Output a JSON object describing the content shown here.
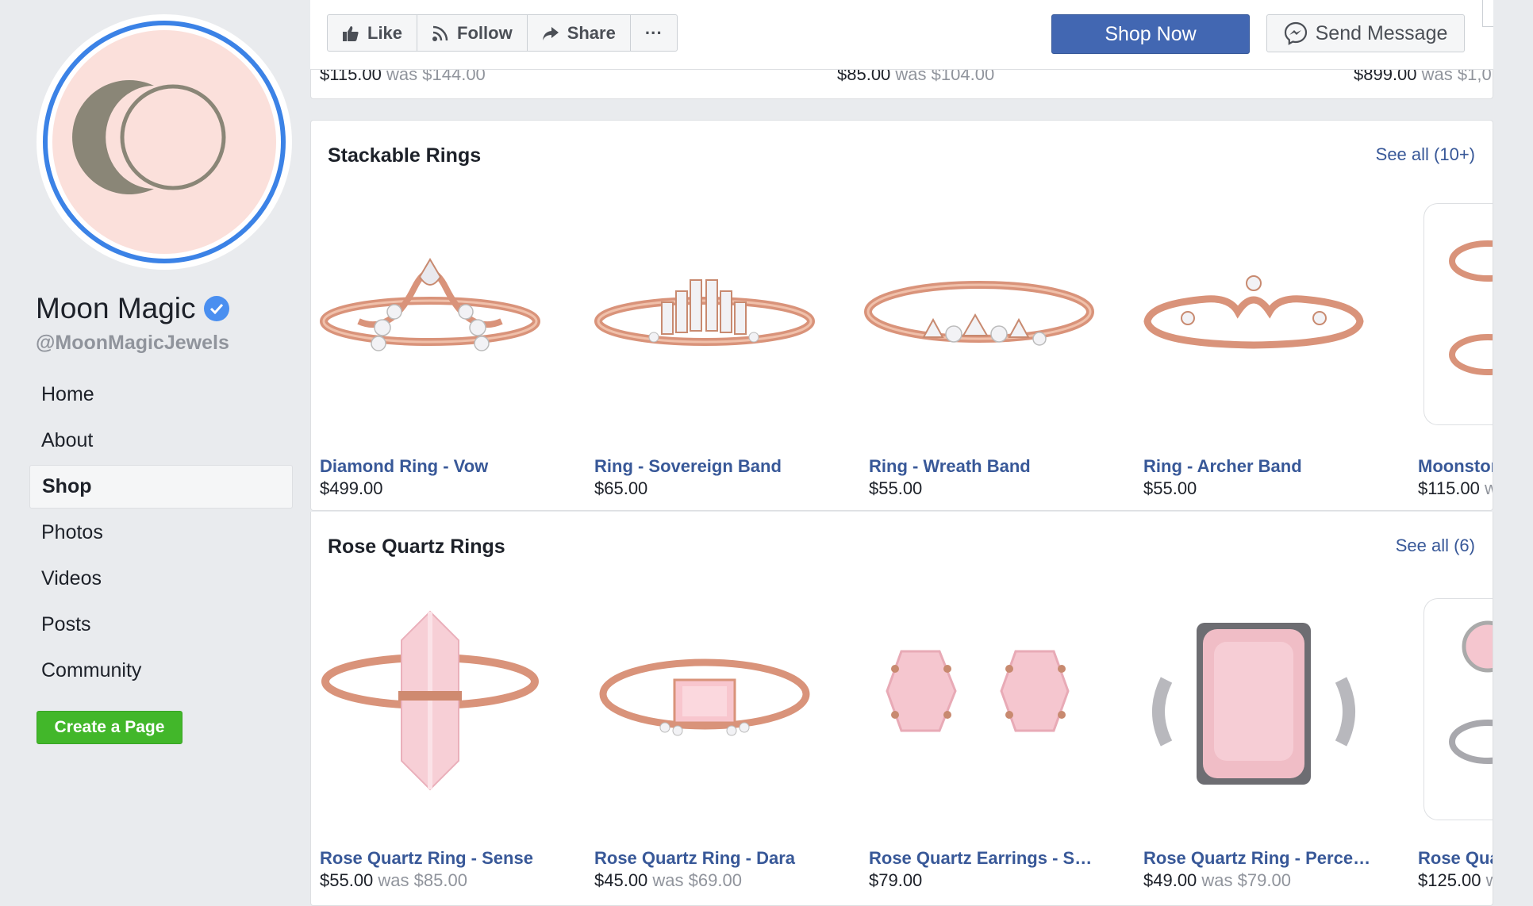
{
  "page": {
    "name": "Moon Magic",
    "handle": "@MoonMagicJewels"
  },
  "nav": [
    {
      "label": "Home"
    },
    {
      "label": "About"
    },
    {
      "label": "Shop"
    },
    {
      "label": "Photos"
    },
    {
      "label": "Videos"
    },
    {
      "label": "Posts"
    },
    {
      "label": "Community"
    }
  ],
  "create_page_label": "Create a Page",
  "actions": {
    "like": "Like",
    "follow": "Follow",
    "share": "Share",
    "more": "···",
    "shop_now": "Shop Now",
    "send_message": "Send Message"
  },
  "top_prices": [
    {
      "now": "$115.00",
      "was": "was $144.00"
    },
    {
      "now": "$85.00",
      "was": "was $104.00"
    },
    {
      "now": "$899.00",
      "was": "was $1,0"
    }
  ],
  "sections": [
    {
      "title": "Stackable Rings",
      "see_all": "See all (10+)",
      "products": [
        {
          "name": "Diamond Ring - Vow",
          "price": "$499.00",
          "was": ""
        },
        {
          "name": "Ring - Sovereign Band",
          "price": "$65.00",
          "was": ""
        },
        {
          "name": "Ring - Wreath Band",
          "price": "$55.00",
          "was": ""
        },
        {
          "name": "Ring - Archer Band",
          "price": "$55.00",
          "was": ""
        },
        {
          "name": "Moonstor",
          "price": "$115.00",
          "was": "w"
        }
      ]
    },
    {
      "title": "Rose Quartz Rings",
      "see_all": "See all (6)",
      "products": [
        {
          "name": "Rose Quartz Ring - Sense",
          "price": "$55.00",
          "was": "was $85.00"
        },
        {
          "name": "Rose Quartz Ring - Dara",
          "price": "$45.00",
          "was": "was $69.00"
        },
        {
          "name": "Rose Quartz Earrings - Sere...",
          "price": "$79.00",
          "was": ""
        },
        {
          "name": "Rose Quartz Ring - Percepti...",
          "price": "$49.00",
          "was": "was $79.00"
        },
        {
          "name": "Rose Qua",
          "price": "$125.00",
          "was": "w"
        }
      ]
    }
  ],
  "colors": {
    "link": "#385898",
    "brand": "#4267b2",
    "create_green": "#42b72a",
    "avatar_ring": "#3b82e6",
    "avatar_bg": "#fbe0db",
    "rose_gold": "#d9937a",
    "rose_quartz": "#f5c6cf"
  },
  "icons": [
    "verified-badge-icon",
    "thumbs-up-icon",
    "rss-icon",
    "share-arrow-icon",
    "messenger-icon"
  ]
}
